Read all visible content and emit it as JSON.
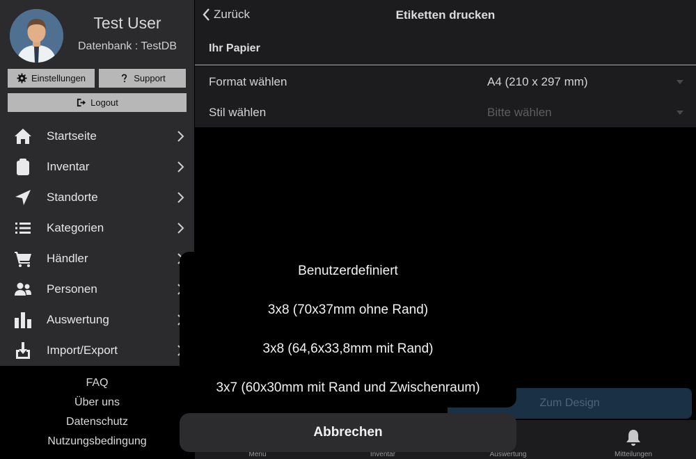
{
  "sidebar": {
    "user_name": "Test User",
    "database": "Datenbank : TestDB",
    "settings_label": "Einstellungen",
    "support_label": "Support",
    "logout_label": "Logout",
    "items": [
      {
        "label": "Startseite",
        "icon": "home-icon"
      },
      {
        "label": "Inventar",
        "icon": "clipboard-icon"
      },
      {
        "label": "Standorte",
        "icon": "location-arrow-icon"
      },
      {
        "label": "Kategorien",
        "icon": "list-icon"
      },
      {
        "label": "Händler",
        "icon": "cart-icon"
      },
      {
        "label": "Personen",
        "icon": "users-icon"
      },
      {
        "label": "Auswertung",
        "icon": "bar-chart-icon"
      },
      {
        "label": "Import/Export",
        "icon": "download-icon"
      }
    ],
    "footer_links": [
      "FAQ",
      "Über uns",
      "Datenschutz",
      "Nutzungsbedingung"
    ]
  },
  "header": {
    "back_label": "Zurück",
    "title": "Etiketten drucken"
  },
  "paper": {
    "section_title": "Ihr Papier",
    "format_label": "Format wählen",
    "format_value": "A4 (210 x 297 mm)",
    "style_label": "Stil wählen",
    "style_placeholder": "Bitte wählen"
  },
  "design_button_label": "Zum Design",
  "tabbar": {
    "tabs": [
      {
        "label": "Menu"
      },
      {
        "label": "Inventar"
      },
      {
        "label": "Auswertung"
      },
      {
        "label": "Mitteilungen"
      }
    ]
  },
  "action_sheet": {
    "options": [
      "Benutzerdefiniert",
      "3x8 (70x37mm ohne Rand)",
      "3x8 (64,6x33,8mm mit Rand)",
      "3x7 (60x30mm mit Rand und Zwischenraum)"
    ],
    "cancel_label": "Abbrechen"
  },
  "colors": {
    "sidebar_bg": "#2b2b2d",
    "panel_bg": "#1c1c1e",
    "button_gray": "#b7b7b7",
    "design_button_bg": "#1a3145"
  }
}
